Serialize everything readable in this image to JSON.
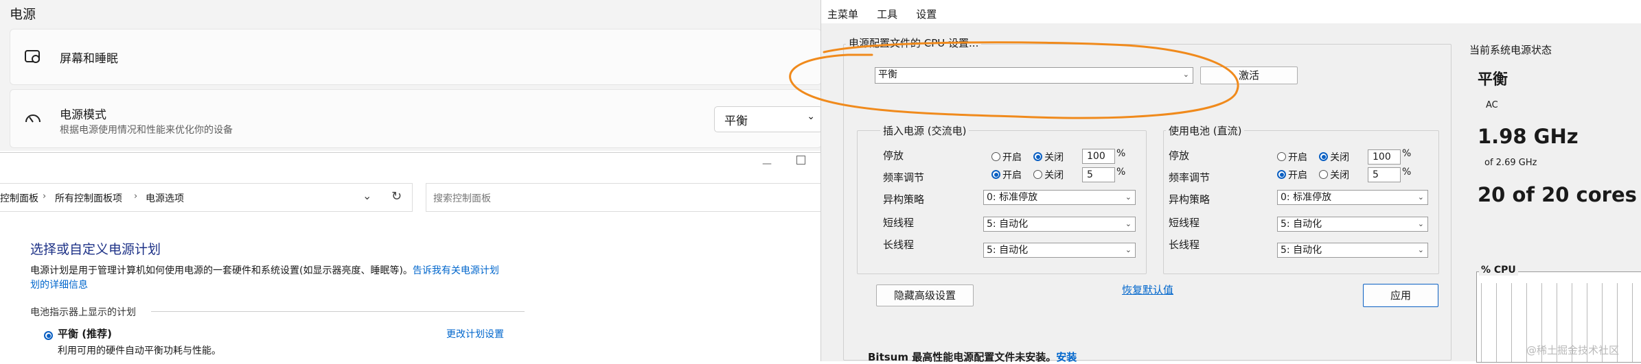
{
  "settings": {
    "title": "电源",
    "screen_sleep": {
      "label": "屏幕和睡眠",
      "icon": "screen-sleep-icon"
    },
    "power_mode": {
      "label": "电源模式",
      "desc": "根据电源使用情况和性能来优化你的设备",
      "value": "平衡",
      "icon": "gauge-icon"
    }
  },
  "control_panel": {
    "breadcrumb": [
      "控制面板",
      "所有控制面板项",
      "电源选项"
    ],
    "search_placeholder": "搜索控制面板",
    "heading": "选择或自定义电源计划",
    "desc_text": "电源计划是用于管理计算机如何使用电源的一套硬件和系统设置(如显示器亮度、睡眠等)。",
    "desc_link_line1": "告诉我有关电源计划",
    "desc_link_line2": "划的详细信息",
    "battery_meter_label": "电池指示器上显示的计划",
    "plan": {
      "name": "平衡 (推荐)",
      "desc": "利用可用的硬件自动平衡功耗与性能。",
      "change_link": "更改计划设置"
    }
  },
  "tool": {
    "menu": [
      "主菜单",
      "工具",
      "设置"
    ],
    "profile_group_title": "电源配置文件的 CPU 设置...",
    "profile_value": "平衡",
    "activate_label": "激活",
    "ac_group": {
      "title": "插入电源 (交流电)",
      "park_label": "停放",
      "park_on": "开启",
      "park_off": "关闭",
      "park_value": "100",
      "park_unit": "%",
      "freq_label": "频率调节",
      "freq_on": "开启",
      "freq_off": "关闭",
      "freq_value": "5",
      "freq_unit": "%",
      "hetero_label": "异构策略",
      "hetero_value": "0: 标准停放",
      "short_label": "短线程",
      "short_value": "5: 自动化",
      "long_label": "长线程",
      "long_value": "5: 自动化"
    },
    "dc_group": {
      "title": "使用电池 (直流)",
      "park_label": "停放",
      "park_on": "开启",
      "park_off": "关闭",
      "park_value": "100",
      "park_unit": "%",
      "freq_label": "频率调节",
      "freq_on": "开启",
      "freq_off": "关闭",
      "freq_value": "5",
      "freq_unit": "%",
      "hetero_label": "异构策略",
      "hetero_value": "0: 标准停放",
      "short_label": "短线程",
      "short_value": "5: 自动化",
      "long_label": "长线程",
      "long_value": "5: 自动化"
    },
    "hide_advanced_label": "隐藏高级设置",
    "restore_defaults_label": "恢复默认值",
    "apply_label": "应用",
    "footer_text": "Bitsum 最高性能电源配置文件未安装。",
    "footer_link": "安装",
    "status": {
      "title": "当前系统电源状态",
      "plan": "平衡",
      "source": "AC",
      "freq": "1.98 GHz",
      "freq_max": "of 2.69 GHz",
      "cores": "20 of 20 cores",
      "cpu_label": "% CPU"
    }
  },
  "watermark": "@稀土掘金技术社区",
  "colors": {
    "annotation": "#f08a1c",
    "link": "#0066cc",
    "radio_accent": "#0a5fc2"
  }
}
